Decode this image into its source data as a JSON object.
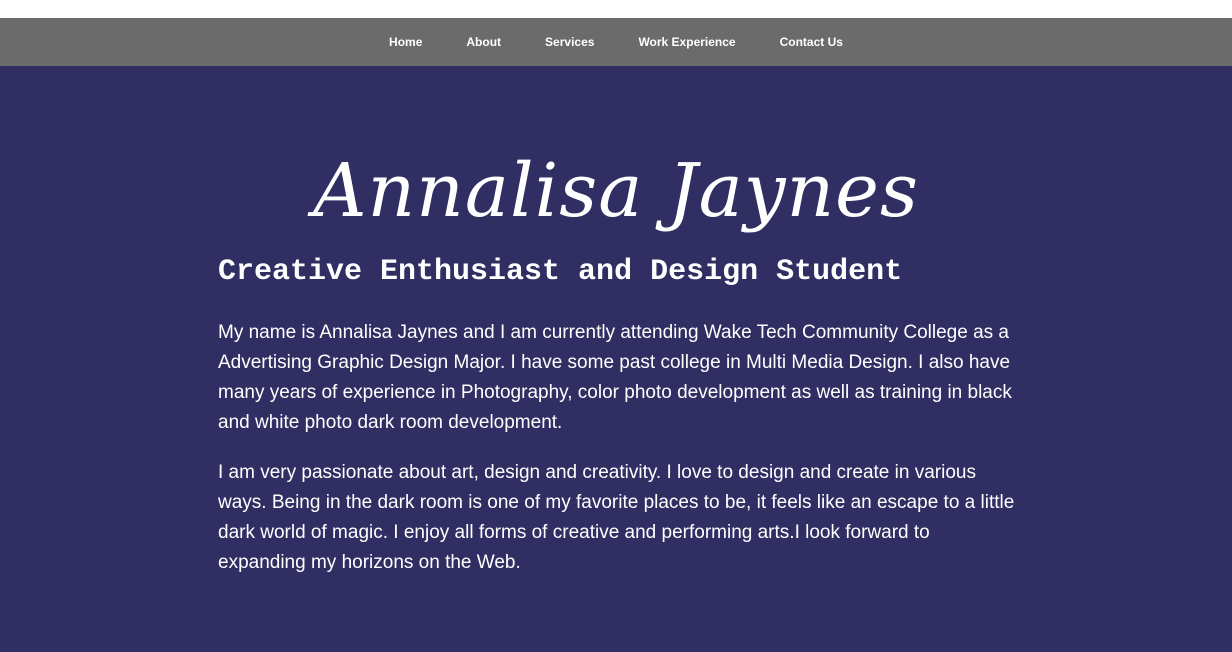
{
  "nav": {
    "items": [
      "Home",
      "About",
      "Services",
      "Work Experience",
      "Contact Us"
    ]
  },
  "hero": {
    "name": "Annalisa Jaynes",
    "subtitle": "Creative Enthusiast and Design Student",
    "paragraphs": [
      "My name is Annalisa Jaynes and I am currently attending Wake Tech Community College as a Advertising Graphic Design Major. I have some past college in Multi Media Design. I also have many years of experience in Photography, color photo development as well as training in black and white photo dark room development.",
      "I am very passionate about art, design and creativity. I love to design and create in various ways. Being in the dark room is one of my favorite places to be, it feels like an escape to a little dark world of magic. I enjoy all forms of creative and performing arts.I look forward to expanding my horizons on the Web."
    ]
  },
  "colors": {
    "nav_background": "#6b6b6b",
    "hero_background": "#302e62",
    "text": "#ffffff"
  }
}
